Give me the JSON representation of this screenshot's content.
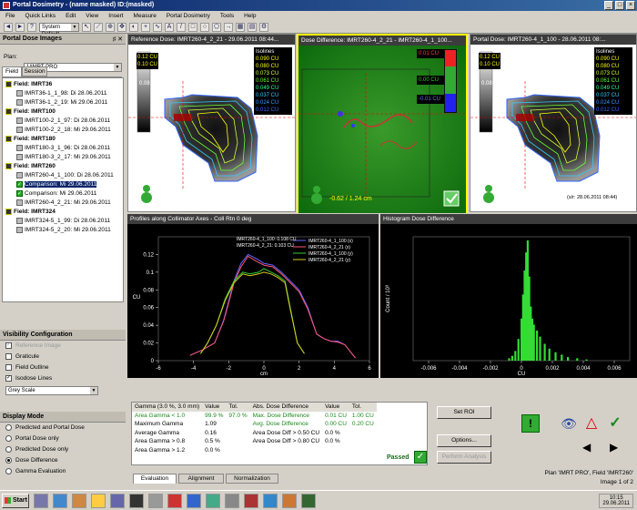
{
  "window": {
    "title": "Portal Dosimetry - (name masked)  ID:(masked)"
  },
  "menu": [
    "File",
    "Quick Links",
    "Edit",
    "View",
    "Insert",
    "Measure",
    "Portal Dosimetry",
    "Tools",
    "Help"
  ],
  "toolbar": {
    "system": "System Default"
  },
  "left": {
    "title": "Portal Dose Images",
    "pin": "♯ ✕",
    "plan_label": "Plan:",
    "plan_value": "1/IMRT PRO",
    "tabs": [
      "Field",
      "Session"
    ],
    "tree": [
      {
        "t": "f",
        "label": "Field: IMRT36"
      },
      {
        "t": "i",
        "label": "IMRT36-1_1_98: Di 28.06.2011"
      },
      {
        "t": "i",
        "label": "IMRT36-1_2_19: Mi 29.06.2011"
      },
      {
        "t": "f",
        "label": "Field: IMRT100"
      },
      {
        "t": "i",
        "label": "IMRT100-2_1_97: Di 28.06.2011"
      },
      {
        "t": "i",
        "label": "IMRT100-2_2_18: Mi 29.06.2011"
      },
      {
        "t": "f",
        "label": "Field: IMRT180"
      },
      {
        "t": "i",
        "label": "IMRT180-3_1_96: Di 28.06.2011"
      },
      {
        "t": "i",
        "label": "IMRT180-3_2_17: Mi 29.06.2011"
      },
      {
        "t": "f",
        "label": "Field: IMRT260"
      },
      {
        "t": "i",
        "label": "IMRT260-4_1_100: Di 28.06.2011"
      },
      {
        "t": "c",
        "label": "Comparison: Mi 29.06.2011",
        "sel": true
      },
      {
        "t": "c",
        "label": "Comparison: Mi 29.06.2011"
      },
      {
        "t": "i",
        "label": "IMRT260-4_2_21: Mi 29.06.2011"
      },
      {
        "t": "f",
        "label": "Field: IMRT324"
      },
      {
        "t": "i",
        "label": "IMRT324-5_1_99: Di 28.06.2011"
      },
      {
        "t": "i",
        "label": "IMRT324-5_2_20: Mi 29.06.2011"
      }
    ],
    "vis_title": "Visibility Configuration",
    "vis": [
      {
        "label": "Reference Image",
        "on": true,
        "dim": true
      },
      {
        "label": "Graticule",
        "on": false
      },
      {
        "label": "Field Outline",
        "on": false
      },
      {
        "label": "Isodose Lines",
        "on": true
      },
      {
        "label": "Blend",
        "on": false,
        "dim": true
      }
    ],
    "colormap": "Grey Scale",
    "mode_title": "Display Mode",
    "modes": [
      {
        "label": "Predicted and Portal Dose",
        "on": false
      },
      {
        "label": "Portal Dose only",
        "on": false
      },
      {
        "label": "Predicted Dose only",
        "on": false
      },
      {
        "label": "Dose Difference",
        "on": true
      },
      {
        "label": "Gamma Evaluation",
        "on": false
      }
    ]
  },
  "images": {
    "ref_title": "Reference Dose: IMRT260-4_2_21 - 29.06.2011 08:44...",
    "diff_title": "Dose Difference: IMRT260-4_2_21 - IMRT260-4_1_100...",
    "portal_title": "Portal Dose: IMRT260-4_1_100 - 28.06.2011 08:...",
    "iso_head": "Isolines",
    "iso_left": [
      "0.12 CU",
      "0.10 CU",
      "0.08 CU"
    ],
    "iso_right": [
      "0.090 CU",
      "0.080 CU",
      "0.073 CU",
      "0.061 CU",
      "0.049 CU",
      "0.037 CU",
      "0.024 CU",
      "0.012 CU"
    ],
    "iso_colors": [
      "#ffff00",
      "#ffff00",
      "#ccff33",
      "#66ff33",
      "#33ff99",
      "#33ccff",
      "#3399ff",
      "#3366ff"
    ],
    "scale_left_mid": "0.10 CU",
    "diff_scale": [
      "0.01 CU",
      "0.00 CU",
      "-0.01 CU"
    ],
    "diff_readout": "-0.62 / 1.24 cm",
    "portal_foot": "(s/r: 28.06.2011 08:44)"
  },
  "profile": {
    "title": "Profiles along Collimator Axes - Coll Rtn 0 deg",
    "vals": [
      "IMRT260-4_1_100: 0.108 CU",
      "IMRT260-4_2_21: 0.103 CU"
    ],
    "xlabel": "cm",
    "ylabel": "CU"
  },
  "histogram": {
    "title": "Histogram Dose Difference",
    "xlabel": "CU",
    "ylabel": "Count / 10³"
  },
  "chart_data": [
    {
      "type": "line",
      "title": "Profiles along Collimator Axes - Coll Rtn 0 deg",
      "xlabel": "cm",
      "ylabel": "CU",
      "xlim": [
        -6,
        6
      ],
      "ylim": [
        0,
        0.14
      ],
      "xticks": [
        -6,
        -4,
        -2,
        0,
        2,
        4,
        6
      ],
      "yticks": [
        0,
        0.02,
        0.04,
        0.06,
        0.08,
        0.1,
        0.12
      ],
      "series": [
        {
          "name": "IMRT260-4_1_100 (x)",
          "color": "#6666ff",
          "x": [
            -4.2,
            -3.5,
            -2.8,
            -2.3,
            -2.1,
            -1.7,
            -1.3,
            -0.9,
            -0.4,
            0,
            0.5,
            1,
            1.5,
            2,
            2.5,
            3,
            3.4,
            3.8,
            4.2,
            4.6,
            5.2
          ],
          "y": [
            0.006,
            0.012,
            0.02,
            0.045,
            0.06,
            0.09,
            0.11,
            0.12,
            0.115,
            0.11,
            0.108,
            0.1,
            0.09,
            0.08,
            0.06,
            0.03,
            0.025,
            0.022,
            0.022,
            0.018,
            0.003
          ]
        },
        {
          "name": "IMRT260-4_2_21 (x)",
          "color": "#ff5577",
          "x": [
            -4.2,
            -3.5,
            -2.8,
            -2.3,
            -2.1,
            -1.7,
            -1.3,
            -0.9,
            -0.4,
            0,
            0.5,
            1,
            1.5,
            2,
            2.5,
            3,
            3.4,
            3.8,
            4.2,
            4.6,
            5.2
          ],
          "y": [
            0.006,
            0.012,
            0.02,
            0.044,
            0.058,
            0.088,
            0.106,
            0.118,
            0.112,
            0.108,
            0.106,
            0.098,
            0.088,
            0.078,
            0.058,
            0.03,
            0.025,
            0.022,
            0.021,
            0.018,
            0.003
          ]
        },
        {
          "name": "IMRT260-4_1_100 (y)",
          "color": "#33cc33",
          "x": [
            -3.6,
            -3.2,
            -2.7,
            -2.2,
            -1.7,
            -1.2,
            -0.8,
            -0.3,
            0,
            0.4,
            0.8,
            1.2,
            1.5,
            1.9,
            2.3
          ],
          "y": [
            0.008,
            0.02,
            0.04,
            0.07,
            0.09,
            0.1,
            0.098,
            0.1,
            0.104,
            0.1,
            0.096,
            0.09,
            0.06,
            0.02,
            0.008
          ]
        },
        {
          "name": "IMRT260-4_2_21 (y)",
          "color": "#ddcc22",
          "x": [
            -3.6,
            -3.2,
            -2.7,
            -2.2,
            -1.7,
            -1.2,
            -0.8,
            -0.3,
            0,
            0.4,
            0.8,
            1.2,
            1.5,
            1.9,
            2.3
          ],
          "y": [
            0.008,
            0.02,
            0.04,
            0.068,
            0.088,
            0.098,
            0.096,
            0.098,
            0.1,
            0.098,
            0.094,
            0.088,
            0.058,
            0.02,
            0.008
          ]
        }
      ]
    },
    {
      "type": "bar",
      "title": "Histogram Dose Difference",
      "xlabel": "CU",
      "ylabel": "Count / 10³",
      "xlim": [
        -0.007,
        0.007
      ],
      "xticks": [
        -0.006,
        -0.004,
        -0.002,
        0,
        0.002,
        0.004,
        0.006
      ],
      "x": [
        -0.0008,
        -0.0006,
        -0.0004,
        -0.0002,
        0,
        0.0001,
        0.0002,
        0.0003,
        0.0004,
        0.0005,
        0.0006,
        0.0007,
        0.0008,
        0.001,
        0.0012,
        0.0015,
        0.0018,
        0.0022,
        0.0026,
        0.003,
        0.0036,
        0.0042
      ],
      "values": [
        0.02,
        0.04,
        0.08,
        0.18,
        0.35,
        0.55,
        0.75,
        0.9,
        1,
        0.7,
        0.45,
        0.35,
        0.3,
        0.25,
        0.2,
        0.14,
        0.1,
        0.07,
        0.05,
        0.03,
        0.02,
        0.01
      ]
    }
  ],
  "results": {
    "gamma_head": "Gamma (3.0 %, 3.0 mm)",
    "value": "Value",
    "tol": "Tol.",
    "abs_head": "Abs. Dose Difference",
    "rows": [
      {
        "a": "Area Gamma < 1.0",
        "b": "99.9 %",
        "c": "97.0 %",
        "d": "Max. Dose Difference",
        "e": "0.01 CU",
        "f": "1.00 CU",
        "green": true
      },
      {
        "a": "Maximum Gamma",
        "b": "1.09",
        "c": "",
        "d": "Avg. Dose Difference",
        "e": "0.00 CU",
        "f": "0.20 CU",
        "green2": true
      },
      {
        "a": "Average Gamma",
        "b": "0.16",
        "c": "",
        "d": "Area Dose Diff > 0.50 CU",
        "e": "0.0 %",
        "f": ""
      },
      {
        "a": "Area Gamma > 0.8",
        "b": "0.5 %",
        "c": "",
        "d": "Area Dose Diff > 0.80 CU",
        "e": "0.0 %",
        "f": ""
      },
      {
        "a": "Area Gamma > 1.2",
        "b": "0.0 %",
        "c": "",
        "d": "",
        "e": "",
        "f": ""
      }
    ],
    "passed": "Passed",
    "set_roi": "Set ROI",
    "options": "Options...",
    "perform": "Perform Analysis",
    "tabs": [
      "Evaluation",
      "Alignment",
      "Normalization"
    ]
  },
  "status": {
    "line1": "Plan 'IMRT PRO', Field 'IMRT260'",
    "line2": "Image 1 of 2"
  },
  "taskbar": {
    "start": "Start",
    "time": "10:15",
    "date": "29.06.2011"
  }
}
